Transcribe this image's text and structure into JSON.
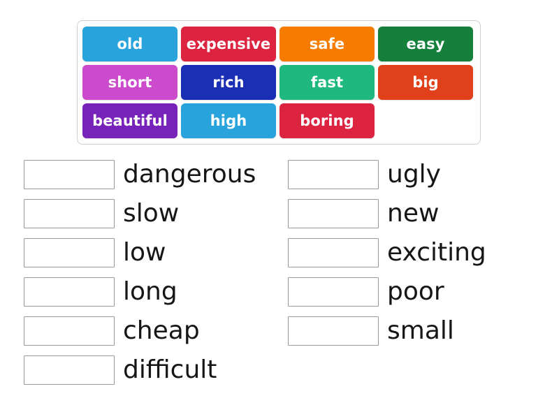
{
  "activity": {
    "type": "match-up-drag-and-drop",
    "word_bank": {
      "rows": [
        [
          {
            "label": "old",
            "color": "#29a3dc"
          },
          {
            "label": "expensive",
            "color": "#dc2340"
          },
          {
            "label": "safe",
            "color": "#f57c00"
          },
          {
            "label": "easy",
            "color": "#14803c"
          }
        ],
        [
          {
            "label": "short",
            "color": "#cc4bcc"
          },
          {
            "label": "rich",
            "color": "#1b2fb5"
          },
          {
            "label": "fast",
            "color": "#1fb87e"
          },
          {
            "label": "big",
            "color": "#e0401a"
          }
        ],
        [
          {
            "label": "beautiful",
            "color": "#7722b8"
          },
          {
            "label": "high",
            "color": "#29a3dc"
          },
          {
            "label": "boring",
            "color": "#dc2340"
          },
          {
            "label": "",
            "color": "transparent",
            "empty": true
          }
        ]
      ]
    },
    "answers": {
      "left_column": [
        {
          "label": "dangerous",
          "slot_value": ""
        },
        {
          "label": "slow",
          "slot_value": ""
        },
        {
          "label": "low",
          "slot_value": ""
        },
        {
          "label": "long",
          "slot_value": ""
        },
        {
          "label": "cheap",
          "slot_value": ""
        },
        {
          "label": "difficult",
          "slot_value": ""
        }
      ],
      "right_column": [
        {
          "label": "ugly",
          "slot_value": ""
        },
        {
          "label": "new",
          "slot_value": ""
        },
        {
          "label": "exciting",
          "slot_value": ""
        },
        {
          "label": "poor",
          "slot_value": ""
        },
        {
          "label": "small",
          "slot_value": ""
        }
      ]
    },
    "colors": {
      "background": "#ffffff",
      "bank_border": "#cfcfcf",
      "slot_border": "#9a9a9a",
      "text": "#161616",
      "tile_text": "#ffffff"
    }
  }
}
